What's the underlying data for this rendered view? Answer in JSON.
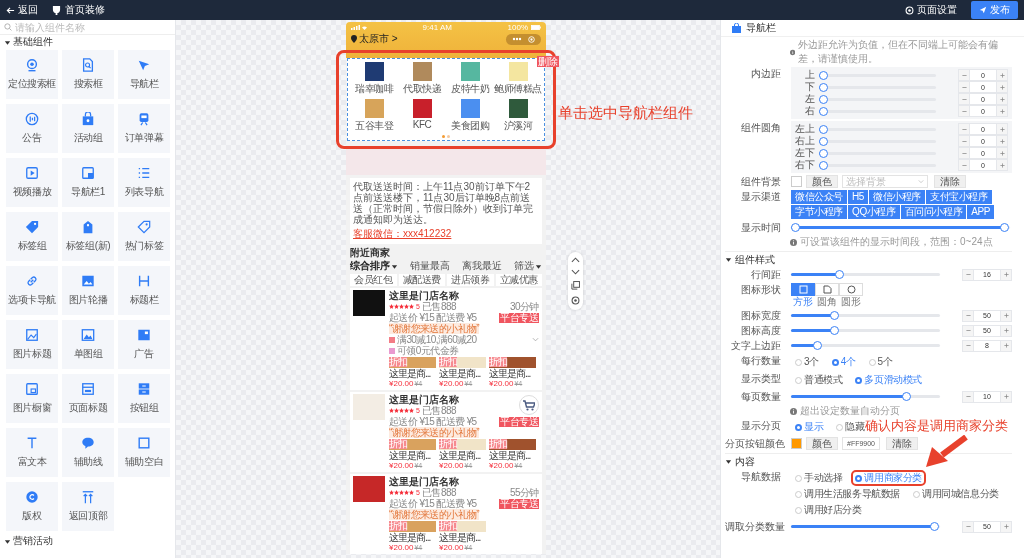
{
  "topbar": {
    "back": "返回",
    "title": "首页装修",
    "page_settings": "页面设置",
    "publish": "发布"
  },
  "components": {
    "search_placeholder": "请输入组件名称",
    "sections": [
      {
        "title": "基础组件",
        "expanded": true,
        "items": [
          "定位搜索框",
          "搜索框",
          "导航栏",
          "公告",
          "活动组",
          "订单弹幕",
          "视频播放",
          "导航栏1",
          "列表导航",
          "标签组",
          "标签组(新)",
          "热门标签",
          "选项卡导航",
          "图片轮播",
          "标题栏",
          "图片标题",
          "单图组",
          "广告",
          "图片橱窗",
          "页面标题",
          "按钮组",
          "富文本",
          "辅助线",
          "辅助空白",
          "版权",
          "返回顶部"
        ]
      },
      {
        "title": "营销活动",
        "expanded": true
      }
    ]
  },
  "canvas": {
    "annotation": "单击选中导航栏组件"
  },
  "phone": {
    "time": "9:41 AM",
    "battery": "100%",
    "city": "太原市 >",
    "nav": {
      "selected": true,
      "highlighted": true,
      "delete": "删除",
      "items": [
        "瑞幸咖啡",
        "代取快递",
        "皮特牛奶",
        "鲍师傅糕点",
        "五谷丰登",
        "KFC",
        "美食团购",
        "沪溪河"
      ],
      "pages": [
        {
          "selected": true
        },
        {
          "selected": false
        }
      ]
    },
    "notice": {
      "text": "代取送送时间：上午11点30前订单下午2点前送送楼下，11点30后订单晚8点前送送（正常时间，节假日除外）收到订单完成通知即为送达。",
      "link": "客服微信：xxx412232"
    },
    "nearby": {
      "title": "附近商家",
      "sorts": [
        {
          "label": "综合排序",
          "selected": true,
          "dropdown": true
        },
        {
          "label": "销量最高",
          "selected": false,
          "dropdown": false
        },
        {
          "label": "离我最近",
          "selected": false,
          "dropdown": false
        },
        {
          "label": "筛选",
          "selected": false,
          "dropdown": true
        }
      ],
      "filters": [
        "会员红包",
        "减配送费",
        "进店领券",
        "立减优惠"
      ]
    },
    "stores": [
      {
        "name": "这里是门店名称",
        "stars": 5,
        "rating": "5",
        "sold": "已售888",
        "time": "30分钟",
        "min_order": "起送价 ¥15",
        "fee": "配送费 ¥5",
        "badge": "平台专送",
        "slogan": "“谢谢您来送的小礼物”",
        "cart": false,
        "expandable": true,
        "promos": [
          {
            "kind": "discount",
            "text": "满30减10,满60减20"
          },
          {
            "kind": "coupon",
            "text": "可领0元代金券"
          }
        ],
        "dishes": [
          {
            "tag": "折扣",
            "name": "这里是商...",
            "price": "¥20.00",
            "old_price": "¥4"
          },
          {
            "tag": "折扣",
            "name": "这里是商...",
            "price": "¥20.00",
            "old_price": "¥4"
          },
          {
            "tag": "折扣",
            "name": "这里是商...",
            "price": "¥20.00",
            "old_price": "¥4"
          }
        ]
      },
      {
        "name": "这里是门店名称",
        "stars": 5,
        "rating": "5",
        "sold": "已售888",
        "min_order": "起送价 ¥15",
        "fee": "配送费 ¥5",
        "badge": "平台专送",
        "slogan": "“谢谢您来送的小礼物”",
        "cart": true,
        "dishes": [
          {
            "tag": "折扣",
            "name": "这里是商...",
            "price": "¥20.00",
            "old_price": "¥4"
          },
          {
            "tag": "折扣",
            "name": "这里是商...",
            "price": "¥20.00",
            "old_price": "¥4"
          },
          {
            "tag": "折扣",
            "name": "这里是商...",
            "price": "¥20.00",
            "old_price": "¥4"
          }
        ]
      },
      {
        "name": "这里是门店名称",
        "stars": 5,
        "rating": "5",
        "sold": "已售888",
        "time": "55分钟",
        "min_order": "起送价 ¥15",
        "fee": "配送费 ¥5",
        "badge": "平台专送",
        "slogan": "“谢谢您来送的小礼物”",
        "cart": false,
        "dishes": [
          {
            "tag": "折扣",
            "name": "这里是商...",
            "price": "¥20.00",
            "old_price": "¥4"
          },
          {
            "tag": "折扣",
            "name": "这里是商...",
            "price": "¥20.00",
            "old_price": "¥4"
          }
        ]
      }
    ]
  },
  "panel": {
    "title": "导航栏",
    "rows": [
      {
        "kind": "note",
        "text": "外边距允许为负值，但在不同端上可能会有偏差，请谨慎使用。"
      },
      {
        "kind": "slider_group",
        "label": "内边距",
        "sliders": [
          {
            "label": "上",
            "level": 0,
            "value": "0"
          },
          {
            "label": "下",
            "level": 0,
            "value": "0"
          },
          {
            "label": "左",
            "level": 0,
            "value": "0"
          },
          {
            "label": "右",
            "level": 0,
            "value": "0"
          }
        ]
      },
      {
        "kind": "slider_group",
        "label": "组件圆角",
        "sliders": [
          {
            "label": "左上",
            "level": 0,
            "value": "0"
          },
          {
            "label": "右上",
            "level": 0,
            "value": "0"
          },
          {
            "label": "左下",
            "level": 0,
            "value": "0"
          },
          {
            "label": "右下",
            "level": 0,
            "value": "0"
          }
        ]
      },
      {
        "kind": "background",
        "label": "组件背景",
        "button": "颜色",
        "placeholder": "选择背景",
        "clear": "清除"
      },
      {
        "kind": "buttons",
        "label": "显示渠道",
        "options": [
          {
            "label": "微信公众号",
            "selected": true
          },
          {
            "label": "H5",
            "selected": true
          },
          {
            "label": "微信小程序",
            "selected": true
          },
          {
            "label": "支付宝小程序",
            "selected": true
          },
          {
            "label": "字节小程序",
            "selected": true
          },
          {
            "label": "QQ小程序",
            "selected": true
          },
          {
            "label": "百问问小程序",
            "selected": true
          },
          {
            "label": "APP",
            "selected": true
          }
        ]
      },
      {
        "kind": "range",
        "label": "显示时间",
        "level": 1
      },
      {
        "kind": "note",
        "text": "可设置该组件的显示时间段，范围：0~24点"
      },
      {
        "kind": "section",
        "title": "组件样式",
        "expanded": true
      },
      {
        "kind": "slider",
        "label": "行间距",
        "level": 0.32,
        "value": "16"
      },
      {
        "kind": "shapes",
        "label": "图标形状",
        "options": [
          {
            "label": "方形",
            "selected": true
          },
          {
            "label": "圆角",
            "selected": false
          },
          {
            "label": "圆形",
            "selected": false
          }
        ]
      },
      {
        "kind": "slider",
        "label": "图标宽度",
        "level": 0.28,
        "value": "50"
      },
      {
        "kind": "slider",
        "label": "图标高度",
        "level": 0.28,
        "value": "50"
      },
      {
        "kind": "slider",
        "label": "文字上边距",
        "level": 0.16,
        "value": "8"
      },
      {
        "kind": "radio",
        "label": "每行数量",
        "options": [
          {
            "label": "3个",
            "selected": false
          },
          {
            "label": "4个",
            "selected": true
          },
          {
            "label": "5个",
            "selected": false
          }
        ]
      },
      {
        "kind": "radio",
        "label": "显示类型",
        "options": [
          {
            "label": "普通模式",
            "selected": false
          },
          {
            "label": "多页滑动模式",
            "selected": true
          }
        ]
      },
      {
        "kind": "slider",
        "label": "每页数量",
        "level": 0.8,
        "value": "10"
      },
      {
        "kind": "note",
        "text": "超出设定数量自动分页"
      },
      {
        "kind": "radio",
        "label": "显示分页",
        "options": [
          {
            "label": "显示",
            "selected": true
          },
          {
            "label": "隐藏",
            "selected": false
          }
        ]
      },
      {
        "kind": "color",
        "label": "分页按钮颜色",
        "button": "颜色",
        "value": "#FF9900",
        "clear": "清除"
      },
      {
        "kind": "section",
        "title": "内容",
        "expanded": true
      },
      {
        "kind": "radio",
        "label": "导航数据",
        "annotation": "确认内容是调用商家分类",
        "options": [
          {
            "label": "手动选择",
            "selected": false,
            "highlighted": false
          },
          {
            "label": "调用商家分类",
            "selected": true,
            "highlighted": true
          },
          {
            "label": "调用生活服务导航数据",
            "selected": false,
            "highlighted": false
          },
          {
            "label": "调用同城信息分类",
            "selected": false,
            "highlighted": false
          },
          {
            "label": "调用好店分类",
            "selected": false,
            "highlighted": false
          }
        ]
      },
      {
        "kind": "slider",
        "label": "调取分类数量",
        "level": 1,
        "value": "50"
      }
    ]
  }
}
